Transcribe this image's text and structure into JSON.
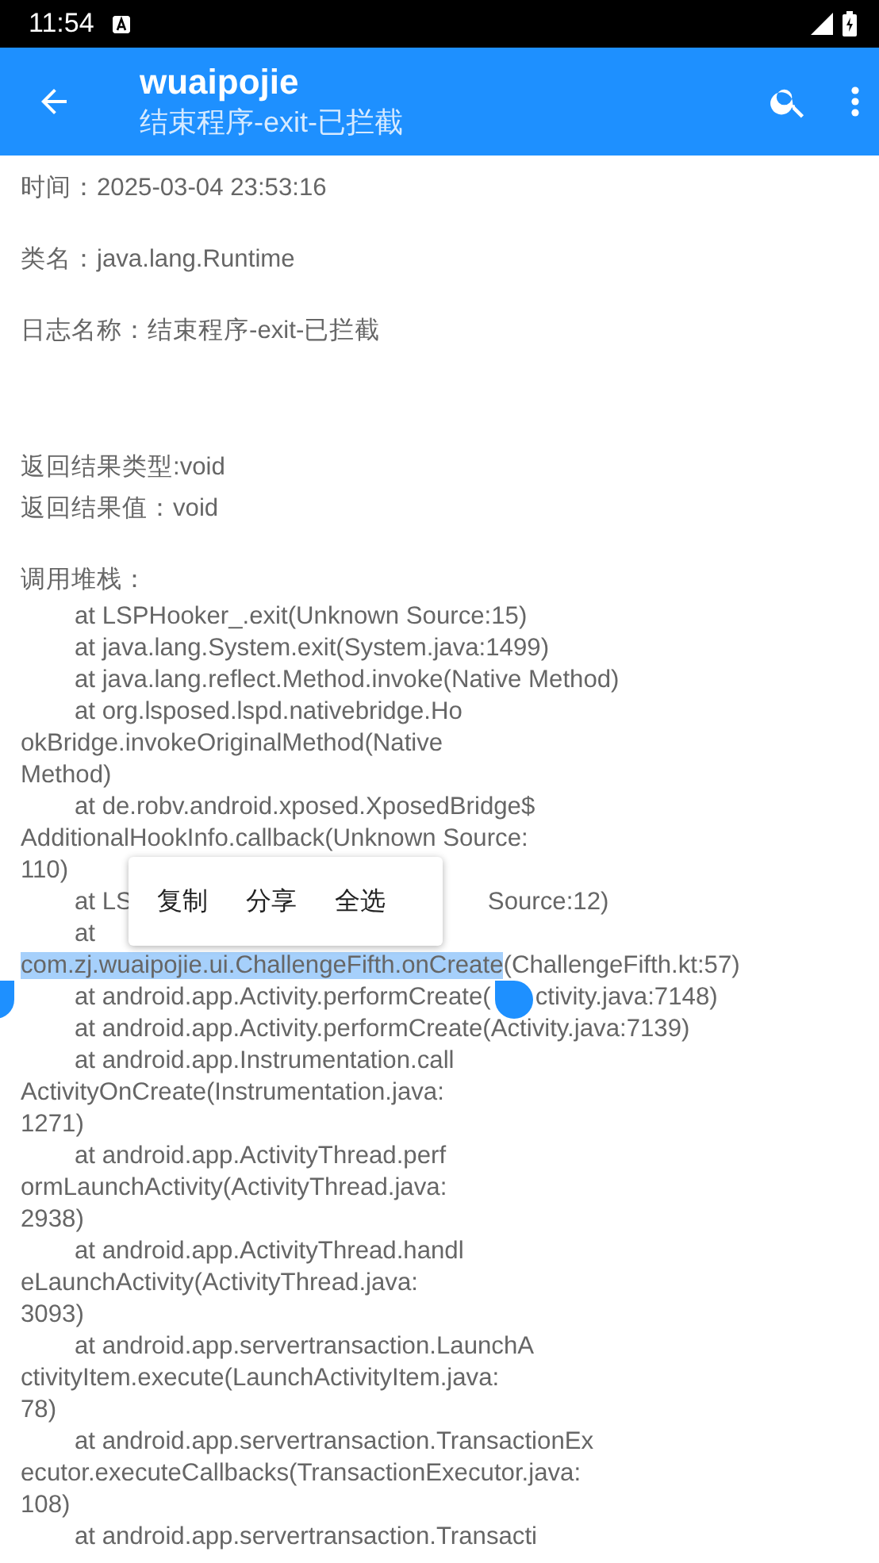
{
  "status_bar": {
    "time": "11:54"
  },
  "app_bar": {
    "title": "wuaipojie",
    "subtitle": "结束程序-exit-已拦截"
  },
  "info_sections": [
    {
      "lines": [
        "时间：2025-03-04 23:53:16"
      ]
    },
    {
      "lines": [
        "类名：java.lang.Runtime"
      ]
    },
    {
      "lines": [
        "日志名称：结束程序-exit-已拦截"
      ]
    },
    {
      "lines": [
        "返回结果类型:void",
        "返回结果值：void"
      ]
    }
  ],
  "stack_title": "调用堆栈：",
  "stack_frames": [
    {
      "lines": [
        "at LSPHooker_.exit(Unknown Source:15)"
      ]
    },
    {
      "lines": [
        "at java.lang.System.exit(System.java:1499)"
      ]
    },
    {
      "lines": [
        "at java.lang.reflect.Method.invoke(Native Method)"
      ]
    },
    {
      "lines": [
        "at org.lsposed.lspd.nativebridge.Ho",
        "okBridge.invokeOriginalMethod(Native",
        "Method)"
      ]
    },
    {
      "lines": [
        "at de.robv.android.xposed.XposedBridge$",
        "AdditionalHookInfo.callback(Unknown Source:",
        "110)"
      ]
    },
    {
      "lines": [
        "at LS"
      ],
      "covered_tail": "Source:12)"
    },
    {
      "lines": [
        "at",
        {
          "segments": [
            {
              "text": "com.zj.wuaipojie.ui.ChallengeFifth.onCreate",
              "selected": true
            },
            {
              "text": "(ChallengeFifth.kt:57)",
              "selected": false
            }
          ]
        }
      ]
    },
    {
      "lines": [
        "at android.app.Activity.performCreate("
      ],
      "covered_tail": "ctivity.java:7148)"
    },
    {
      "lines": [
        "at android.app.Activity.performCreate(Activity.java:7139)"
      ]
    },
    {
      "lines": [
        "at android.app.Instrumentation.call",
        "ActivityOnCreate(Instrumentation.java:",
        "1271)"
      ]
    },
    {
      "lines": [
        "at android.app.ActivityThread.perf",
        "ormLaunchActivity(ActivityThread.java:",
        "2938)"
      ]
    },
    {
      "lines": [
        "at android.app.ActivityThread.handl",
        "eLaunchActivity(ActivityThread.java:",
        "3093)"
      ]
    },
    {
      "lines": [
        "at android.app.servertransaction.LaunchA",
        "ctivityItem.execute(LaunchActivityItem.java:",
        "78)"
      ]
    },
    {
      "lines": [
        "at android.app.servertransaction.TransactionEx",
        "ecutor.executeCallbacks(TransactionExecutor.java:",
        "108)"
      ]
    },
    {
      "lines": [
        "at android.app.servertransaction.Transacti"
      ]
    }
  ],
  "context_menu": {
    "items": [
      "复制",
      "分享",
      "全选"
    ]
  }
}
